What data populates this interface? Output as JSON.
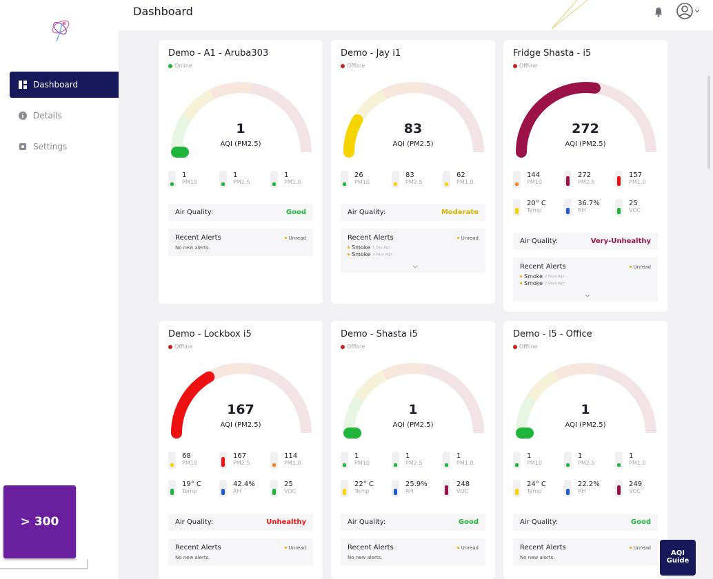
{
  "header": {
    "title": "Dashboard"
  },
  "sidebar": {
    "items": [
      {
        "label": "Dashboard",
        "icon": "grid-icon",
        "active": true
      },
      {
        "label": "Details",
        "icon": "info-icon",
        "active": false
      },
      {
        "label": "Settings",
        "icon": "gear-icon",
        "active": false
      }
    ],
    "aqi_filter": "> 300"
  },
  "aqi_guide": {
    "line1": "AQI",
    "line2": "Guide"
  },
  "colors": {
    "good": "#1eb53a",
    "moderate": "#f5d400",
    "unhealthy": "#ee1111",
    "very_unhealthy": "#9b1248",
    "sensitive": "#f58220",
    "online": "#1eb53a",
    "offline": "#c81e1e",
    "nav_active": "#17195a"
  },
  "devices": [
    {
      "name": "Demo - A1 - Aruba303",
      "status": "Online",
      "aqi": "1",
      "aqi_label": "AQI (PM2.5)",
      "aqi_level": 0.004,
      "metrics": [
        {
          "value": "1",
          "label": "PM10",
          "level": "good"
        },
        {
          "value": "1",
          "label": "PM2.5",
          "level": "good"
        },
        {
          "value": "1",
          "label": "PM1.0",
          "level": "good"
        }
      ],
      "air_quality_label": "Air Quality:",
      "air_quality": "Good",
      "alerts_title": "Recent Alerts",
      "unread_label": "Unread",
      "no_alerts": "No new alerts.",
      "alerts": []
    },
    {
      "name": "Demo - Jay i1",
      "status": "Offline",
      "aqi": "83",
      "aqi_label": "AQI (PM2.5)",
      "aqi_level": 0.166,
      "metrics": [
        {
          "value": "26",
          "label": "PM10",
          "level": "good"
        },
        {
          "value": "83",
          "label": "PM2.5",
          "level": "moderate"
        },
        {
          "value": "62",
          "label": "PM1.0",
          "level": "moderate"
        }
      ],
      "air_quality_label": "Air Quality:",
      "air_quality": "Moderate",
      "alerts_title": "Recent Alerts",
      "unread_label": "Unread",
      "no_alerts": "",
      "alerts": [
        {
          "text": "Smoke",
          "time": "1 Day Ago"
        },
        {
          "text": "Smoke",
          "time": "2 Days Ago"
        }
      ]
    },
    {
      "name": "Fridge Shasta - i5",
      "status": "Offline",
      "aqi": "272",
      "aqi_label": "AQI (PM2.5)",
      "aqi_level": 0.544,
      "metrics": [
        {
          "value": "144",
          "label": "PM10",
          "level": "sensitive"
        },
        {
          "value": "272",
          "label": "PM2.5",
          "level": "very_unhealthy"
        },
        {
          "value": "157",
          "label": "PM1.0",
          "level": "unhealthy"
        },
        {
          "value": "20° C",
          "label": "Temp",
          "level": "moderate"
        },
        {
          "value": "36.7%",
          "label": "RH",
          "level": "blue"
        },
        {
          "value": "25",
          "label": "VOC",
          "level": "good"
        }
      ],
      "air_quality_label": "Air Quality:",
      "air_quality": "Very-Unhealthy",
      "alerts_title": "Recent Alerts",
      "unread_label": "Unread",
      "no_alerts": "",
      "alerts": [
        {
          "text": "Smoke",
          "time": "2 Days Ago"
        },
        {
          "text": "Smoke",
          "time": "2 Days Ago"
        }
      ]
    },
    {
      "name": "Demo - Lockbox i5",
      "status": "Offline",
      "aqi": "167",
      "aqi_label": "AQI (PM2.5)",
      "aqi_level": 0.334,
      "metrics": [
        {
          "value": "68",
          "label": "PM10",
          "level": "moderate"
        },
        {
          "value": "167",
          "label": "PM2.5",
          "level": "unhealthy"
        },
        {
          "value": "114",
          "label": "PM1.0",
          "level": "sensitive"
        },
        {
          "value": "19° C",
          "label": "Temp",
          "level": "good"
        },
        {
          "value": "42.4%",
          "label": "RH",
          "level": "blue"
        },
        {
          "value": "25",
          "label": "VOC",
          "level": "good"
        }
      ],
      "air_quality_label": "Air Quality:",
      "air_quality": "Unhealthy",
      "alerts_title": "Recent Alerts",
      "unread_label": "Unread",
      "no_alerts": "No new alerts.",
      "alerts": []
    },
    {
      "name": "Demo - Shasta i5",
      "status": "Offline",
      "aqi": "1",
      "aqi_label": "AQI (PM2.5)",
      "aqi_level": 0.004,
      "metrics": [
        {
          "value": "1",
          "label": "PM10",
          "level": "good"
        },
        {
          "value": "1",
          "label": "PM2.5",
          "level": "good"
        },
        {
          "value": "1",
          "label": "PM1.0",
          "level": "good"
        },
        {
          "value": "22° C",
          "label": "Temp",
          "level": "moderate"
        },
        {
          "value": "25.9%",
          "label": "RH",
          "level": "blue"
        },
        {
          "value": "248",
          "label": "VOC",
          "level": "very_unhealthy"
        }
      ],
      "air_quality_label": "Air Quality:",
      "air_quality": "Good",
      "alerts_title": "Recent Alerts",
      "unread_label": "Unread",
      "no_alerts": "No new alerts.",
      "alerts": []
    },
    {
      "name": "Demo - I5 - Office",
      "status": "Offline",
      "aqi": "1",
      "aqi_label": "AQI (PM2.5)",
      "aqi_level": 0.004,
      "metrics": [
        {
          "value": "1",
          "label": "PM10",
          "level": "good"
        },
        {
          "value": "1",
          "label": "PM2.5",
          "level": "good"
        },
        {
          "value": "1",
          "label": "PM1.0",
          "level": "good"
        },
        {
          "value": "24° C",
          "label": "Temp",
          "level": "moderate"
        },
        {
          "value": "22.2%",
          "label": "RH",
          "level": "blue"
        },
        {
          "value": "249",
          "label": "VOC",
          "level": "very_unhealthy"
        }
      ],
      "air_quality_label": "Air Quality:",
      "air_quality": "Good",
      "alerts_title": "Recent Alerts",
      "unread_label": "Unread",
      "no_alerts": "No new alerts.",
      "alerts": []
    }
  ]
}
